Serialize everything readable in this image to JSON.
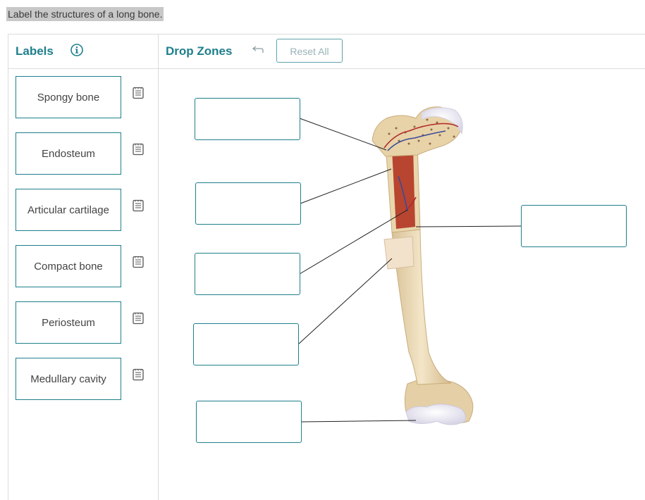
{
  "prompt": "Label the structures of a long bone.",
  "labels_panel": {
    "title": "Labels",
    "info_icon": "info-icon",
    "items": [
      {
        "label": "Spongy bone"
      },
      {
        "label": "Endosteum"
      },
      {
        "label": "Articular cartilage"
      },
      {
        "label": "Compact bone"
      },
      {
        "label": "Periosteum"
      },
      {
        "label": "Medullary cavity"
      }
    ]
  },
  "drop_panel": {
    "title": "Drop Zones",
    "undo_icon": "undo-arrow-icon",
    "reset_label": "Reset All"
  },
  "colors": {
    "accent": "#1f7f8c",
    "bone": "#ecd9b3",
    "marrow": "#b8452f"
  }
}
